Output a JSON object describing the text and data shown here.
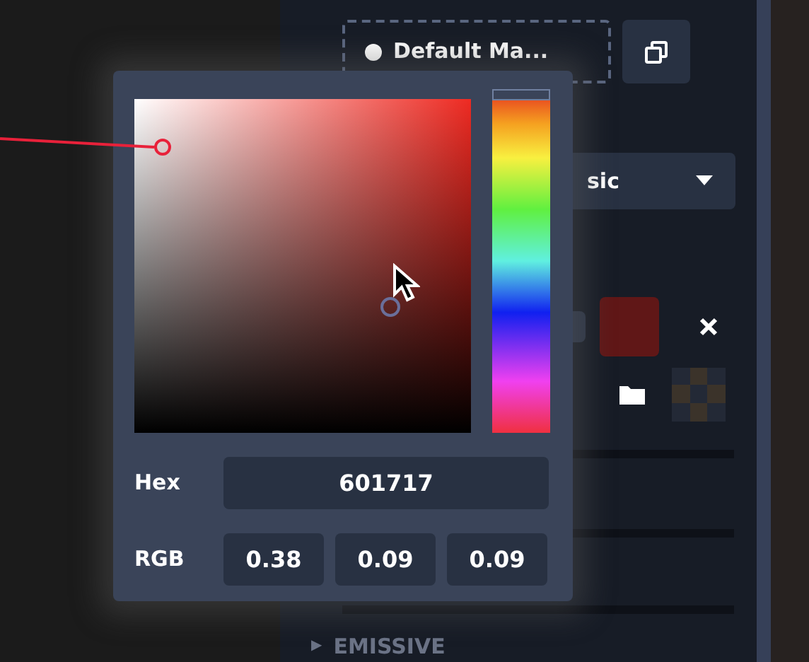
{
  "panel": {
    "material_button": "Default Ma...",
    "dropdown": "sic",
    "section_arrow": "▶",
    "section": "EMISSIVE"
  },
  "color_picker": {
    "hue_slider": {
      "level": 0
    },
    "hex_label": "Hex",
    "hex_value": "601717",
    "rgb_label": "RGB",
    "rgb_values": [
      "0.38",
      "0.09",
      "0.09"
    ]
  }
}
